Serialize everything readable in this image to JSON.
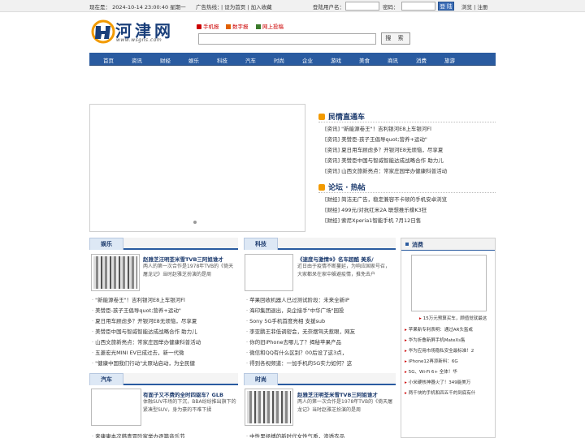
{
  "topbar": {
    "datetime": "现在是：  2024-10-14 23:00:40 星期一",
    "hotline": "广告热线：",
    "links": "| 设为首页 | 加入收藏",
    "login_label": "登陆用户名：",
    "password_label": "密码：",
    "login_button": "登 陆",
    "browse_register": "浏览 | 注册"
  },
  "logo": {
    "name": "河津网",
    "url": "www.wsgns.com"
  },
  "quick_links": [
    "手机报",
    "数字报",
    "网上投稿"
  ],
  "search": {
    "placeholder": "",
    "button": "搜 索"
  },
  "nav": [
    "首页",
    "资讯",
    "财经",
    "娱乐",
    "科技",
    "汽车",
    "时尚",
    "企业",
    "游戏",
    "美食",
    "商讯",
    "消费",
    "旅游"
  ],
  "minqing": {
    "title": "民情直通车",
    "items": [
      "[资讯] \"新能源卷王\"！吉利银河E8上车银河Fl",
      "[资讯] 美赞臣-孩子王倡导quot;营养+运动\"",
      "[资讯] 夏日用车顾虑多？开银河E8无烦恼，尽享夏",
      "[资讯] 美赞臣中国与智威智能达成战略合作 助力儿",
      "[资讯] 山西文旅新亮点：常家庄园举办健康科普活动"
    ]
  },
  "luntan": {
    "title": "论坛 · 热帖",
    "items": [
      "[财经] 简洁无广告，稳定兼容不卡顿的手机安卓浏览",
      "[财经] 499元/对抗红米2A 联想推乐檬K3狂",
      "[财经] 索尼Xperia1智能手机 7月12日售"
    ]
  },
  "yule": {
    "tab": "娱乐",
    "featured_title": "赵雅芝汪明荃米雪TVB三阿姐谁才",
    "featured_desc": "两人的第一次合作是1978年TVB的《倚天屠龙记》当时赵雅芝扮演的是周",
    "list": [
      "\"新能源卷王\"！吉利银河E8上车银河Fl",
      "美赞臣-孩子王倡导quot;营养+运动\"",
      "夏日用车顾虑多？开银河E8无烦恼，尽享夏",
      "美赞臣中国与智威智能达成战略合作 助力儿",
      "山西文旅新亮点：常家庄园举办健康科普活动",
      "五菱宏光MINI EV已成过去，新一代微",
      "\"健康中国我们行动\"太原站启动，为全民健"
    ]
  },
  "keji": {
    "tab": "科技",
    "featured_title": "《速度与激情9》名车超酷 美系/",
    "featured_desc": "近日由于疫情不断蔓延，为响应国家号召，大家都呆在家中躲避疫情，推免去户",
    "list": [
      "苹果回收机器人已过测试阶段：未来全新iP",
      "海印集团退出，央企接手\"中华广场\"园投",
      "Sony 5G手机首度亮相 支援sub",
      "李亚鹏王菲低调密会，无奈摆驾夫惹眼，网友",
      "你的旧iPhone去哪儿了？揭秘苹果产品",
      "微信和QQ有什么区别？00后设了这3点，",
      "得到各视频道：一加手机的5G实力如何？这"
    ]
  },
  "qiche": {
    "tab": "汽车",
    "featured_title": "有面子又不费的全时四驱车？GLB",
    "featured_desc": "体融SUV市场的下沉，BBA纷纷推出旗下的紧凑型SUV，身为豪的不难下揉",
    "list": [
      "来康康本次韩青冒险家举办逐篇音乐节"
    ]
  },
  "shishang": {
    "tab": "时尚",
    "featured_title": "赵雅芝汪明荃米雪TVB三阿姐谁才",
    "featured_desc": "两人的第一次合作是1978年TVB的《倚天屠龙记》当时赵雅芝扮演的是周",
    "list": [
      "中性里拯搏的新时代女性气质，渗透衣品"
    ]
  },
  "xiaofei": {
    "tab": "消费",
    "caption": "15万元预算买车，顾值觉就最这",
    "items": [
      "苹果新专利表明：通过AR头盔或",
      "华为折叠新屏手机MateXs售",
      "华为应用市场隐私安全最标准！2",
      "iPhone12再添新料：6G",
      "5G、Wi-Fi 6+ 全体！华",
      "小米硬核神器火了！349能美万",
      "两千块的手机和四五千的到底有什"
    ]
  }
}
